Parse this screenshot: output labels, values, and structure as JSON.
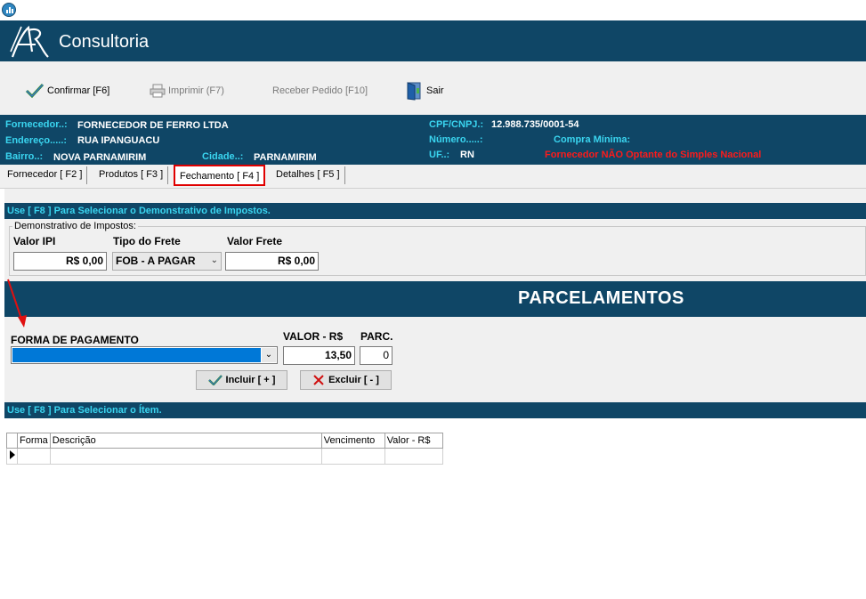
{
  "brand": {
    "name": "Consultoria",
    "logo_text": "AR"
  },
  "toolbar": {
    "confirm_label": "Confirmar [F6]",
    "print_label": "Imprimir  (F7)",
    "receive_label": "Receber Pedido [F10]",
    "exit_label": "Sair"
  },
  "supplier": {
    "fornecedor_label": "Fornecedor..:",
    "fornecedor_value": "FORNECEDOR DE FERRO LTDA",
    "endereco_label": "Endereço.....:",
    "endereco_value": "RUA IPANGUACU",
    "bairro_label": "Bairro..:",
    "bairro_value": "NOVA PARNAMIRIM",
    "cidade_label": "Cidade..:",
    "cidade_value": "PARNAMIRIM",
    "cpf_label": "CPF/CNPJ.:",
    "cpf_value": "12.988.735/0001-54",
    "numero_label": "Número.....:",
    "compra_label": "Compra Mínima:",
    "uf_label": "UF..:",
    "uf_value": "RN",
    "simples_warning": "Fornecedor NÃO Optante do Simples Nacional"
  },
  "tabs": [
    {
      "label": "Fornecedor [ F2 ]"
    },
    {
      "label": "Produtos [ F3 ]"
    },
    {
      "label": "Fechamento [ F4 ]"
    },
    {
      "label": "Detalhes [ F5 ]"
    }
  ],
  "taxes": {
    "bar_text": "Use [ F8 ] Para Selecionar o Demonstrativo de Impostos.",
    "group_title": "Demonstrativo de Impostos:",
    "ipi_label": "Valor IPI",
    "ipi_value": "R$ 0,00",
    "frete_tipo_label": "Tipo do Frete",
    "frete_tipo_value": "FOB - A PAGAR",
    "frete_valor_label": "Valor Frete",
    "frete_valor_value": "R$ 0,00"
  },
  "parcelamentos": {
    "title": "PARCELAMENTOS",
    "forma_label": "FORMA DE PAGAMENTO",
    "forma_value": "",
    "valor_label": "VALOR - R$",
    "valor_value": "13,50",
    "parc_label": "PARC.",
    "parc_value": "0",
    "incluir_label": "Incluir [ + ]",
    "excluir_label": "Excluir [ - ]"
  },
  "items": {
    "bar_text": "Use [ F8 ] Para Selecionar o Ítem.",
    "columns": [
      "Forma",
      "Descrição",
      "Vencimento",
      "Valor - R$"
    ]
  },
  "colors": {
    "header_bg": "#0f4666",
    "label_cyan": "#3ad5f0",
    "warning_red": "#ff1a1a",
    "selection_blue": "#0078d7"
  }
}
